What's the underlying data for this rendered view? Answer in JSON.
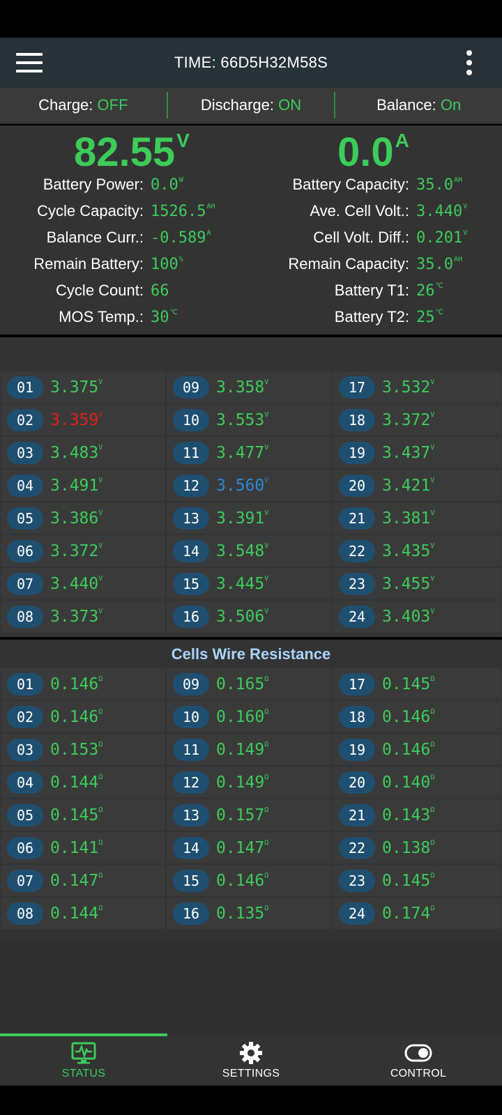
{
  "app": {
    "title": "TIME: 66D5H32M58S"
  },
  "state": {
    "charge_label": "Charge: ",
    "charge_value": "OFF",
    "discharge_label": "Discharge: ",
    "discharge_value": "ON",
    "balance_label": "Balance: ",
    "balance_value": "On"
  },
  "summary": {
    "voltage": "82.55",
    "voltage_unit": "V",
    "current": "0.0",
    "current_unit": "A",
    "left": [
      {
        "label": "Battery Power:",
        "value": "0.0",
        "unit": "W"
      },
      {
        "label": "Cycle Capacity:",
        "value": "1526.5",
        "unit": "AH"
      },
      {
        "label": "Balance Curr.:",
        "value": "-0.589",
        "unit": "A"
      },
      {
        "label": "Remain Battery:",
        "value": "100",
        "unit": "%"
      },
      {
        "label": "Cycle Count:",
        "value": "66",
        "unit": ""
      },
      {
        "label": "MOS Temp.:",
        "value": "30",
        "unit": "℃"
      }
    ],
    "right": [
      {
        "label": "Battery Capacity:",
        "value": "35.0",
        "unit": "AH"
      },
      {
        "label": "Ave. Cell Volt.:",
        "value": "3.440",
        "unit": "V"
      },
      {
        "label": "Cell Volt. Diff.:",
        "value": "0.201",
        "unit": "V"
      },
      {
        "label": "Remain Capacity:",
        "value": "35.0",
        "unit": "AH"
      },
      {
        "label": "Battery T1:",
        "value": "26",
        "unit": "℃"
      },
      {
        "label": "Battery T2:",
        "value": "25",
        "unit": "℃"
      }
    ]
  },
  "cell_voltages": {
    "unit": "V",
    "rows": [
      [
        {
          "n": "01",
          "v": "3.375"
        },
        {
          "n": "09",
          "v": "3.358"
        },
        {
          "n": "17",
          "v": "3.532"
        }
      ],
      [
        {
          "n": "02",
          "v": "3.359",
          "status": "low"
        },
        {
          "n": "10",
          "v": "3.553"
        },
        {
          "n": "18",
          "v": "3.372"
        }
      ],
      [
        {
          "n": "03",
          "v": "3.483"
        },
        {
          "n": "11",
          "v": "3.477"
        },
        {
          "n": "19",
          "v": "3.437"
        }
      ],
      [
        {
          "n": "04",
          "v": "3.491"
        },
        {
          "n": "12",
          "v": "3.560",
          "status": "high"
        },
        {
          "n": "20",
          "v": "3.421"
        }
      ],
      [
        {
          "n": "05",
          "v": "3.386"
        },
        {
          "n": "13",
          "v": "3.391"
        },
        {
          "n": "21",
          "v": "3.381"
        }
      ],
      [
        {
          "n": "06",
          "v": "3.372"
        },
        {
          "n": "14",
          "v": "3.548"
        },
        {
          "n": "22",
          "v": "3.435"
        }
      ],
      [
        {
          "n": "07",
          "v": "3.440"
        },
        {
          "n": "15",
          "v": "3.445"
        },
        {
          "n": "23",
          "v": "3.455"
        }
      ],
      [
        {
          "n": "08",
          "v": "3.373"
        },
        {
          "n": "16",
          "v": "3.506"
        },
        {
          "n": "24",
          "v": "3.403"
        }
      ]
    ]
  },
  "wire_resistance": {
    "title": "Cells Wire Resistance",
    "unit": "Ω",
    "rows": [
      [
        {
          "n": "01",
          "v": "0.146"
        },
        {
          "n": "09",
          "v": "0.165"
        },
        {
          "n": "17",
          "v": "0.145"
        }
      ],
      [
        {
          "n": "02",
          "v": "0.146"
        },
        {
          "n": "10",
          "v": "0.160"
        },
        {
          "n": "18",
          "v": "0.146"
        }
      ],
      [
        {
          "n": "03",
          "v": "0.153"
        },
        {
          "n": "11",
          "v": "0.149"
        },
        {
          "n": "19",
          "v": "0.146"
        }
      ],
      [
        {
          "n": "04",
          "v": "0.144"
        },
        {
          "n": "12",
          "v": "0.149"
        },
        {
          "n": "20",
          "v": "0.140"
        }
      ],
      [
        {
          "n": "05",
          "v": "0.145"
        },
        {
          "n": "13",
          "v": "0.157"
        },
        {
          "n": "21",
          "v": "0.143"
        }
      ],
      [
        {
          "n": "06",
          "v": "0.141"
        },
        {
          "n": "14",
          "v": "0.147"
        },
        {
          "n": "22",
          "v": "0.138"
        }
      ],
      [
        {
          "n": "07",
          "v": "0.147"
        },
        {
          "n": "15",
          "v": "0.146"
        },
        {
          "n": "23",
          "v": "0.145"
        }
      ],
      [
        {
          "n": "08",
          "v": "0.144"
        },
        {
          "n": "16",
          "v": "0.135"
        },
        {
          "n": "24",
          "v": "0.174"
        }
      ]
    ]
  },
  "nav": {
    "status": "STATUS",
    "settings": "SETTINGS",
    "control": "CONTROL"
  },
  "colors": {
    "accent": "#3dcc5a",
    "app_bar": "#263238",
    "cell_badge": "#1f4f70",
    "low": "#e51c1c",
    "high": "#2c87d6",
    "section_title": "#a8d4ff"
  }
}
